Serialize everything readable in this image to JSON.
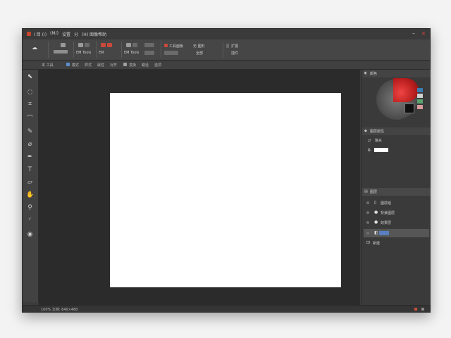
{
  "titlebar": {
    "menus": [
      "I 目 (I)",
      "(M/)",
      "设置",
      "分 ",
      "(H) 图像帮助"
    ],
    "minimize": "–",
    "close": "×"
  },
  "ribbon": {
    "groups": [
      {
        "label": "",
        "icon": "cloud-icon"
      },
      {
        "label": "",
        "icon": "brush-icon"
      },
      {
        "label": "EM Tools",
        "icon": "layers-icon"
      },
      {
        "label": "EM Tools",
        "icon": "select-icon"
      },
      {
        "label": "EM Tools",
        "icon": "shape-icon"
      },
      {
        "label": "",
        "icon": "grid-icon"
      },
      {
        "label": "工具面板",
        "icon": "tools-icon"
      },
      {
        "label": "无 图形",
        "icon": "text-icon"
      },
      {
        "label": "扩展",
        "icon": "extend-icon"
      }
    ],
    "sub_labels": [
      "EM Tools",
      "EM",
      "EM Tools",
      "EM",
      "全部",
      "插件"
    ]
  },
  "options_bar": {
    "items": [
      "本 工具",
      "模式",
      "样式",
      "属性",
      "对齐",
      "变换",
      "路径",
      "选项"
    ]
  },
  "tools": [
    "select-icon",
    "lasso-icon",
    "crop-icon",
    "eyedropper-icon",
    "brush-icon",
    "eraser-icon",
    "pen-icon",
    "type-icon",
    "shape-icon",
    "hand-icon",
    "zoom-icon",
    "fill-icon",
    "camera-icon"
  ],
  "panels": {
    "color": {
      "title": "颜色"
    },
    "properties": {
      "title": "图层属性",
      "row1": "填充",
      "row2": ""
    },
    "layers": {
      "title": "图层",
      "items": [
        {
          "label": "图层组"
        },
        {
          "label": "背景图层"
        },
        {
          "label": "效果层"
        },
        {
          "label": ""
        },
        {
          "label": "新建"
        }
      ]
    }
  },
  "statusbar": {
    "text": "100% 文档: 640×480"
  },
  "colors": {
    "accent": "#c94a3b",
    "canvas_bg": "#2b2b2b",
    "artboard": "#ffffff",
    "layer_chip": "#5a7fc0"
  }
}
